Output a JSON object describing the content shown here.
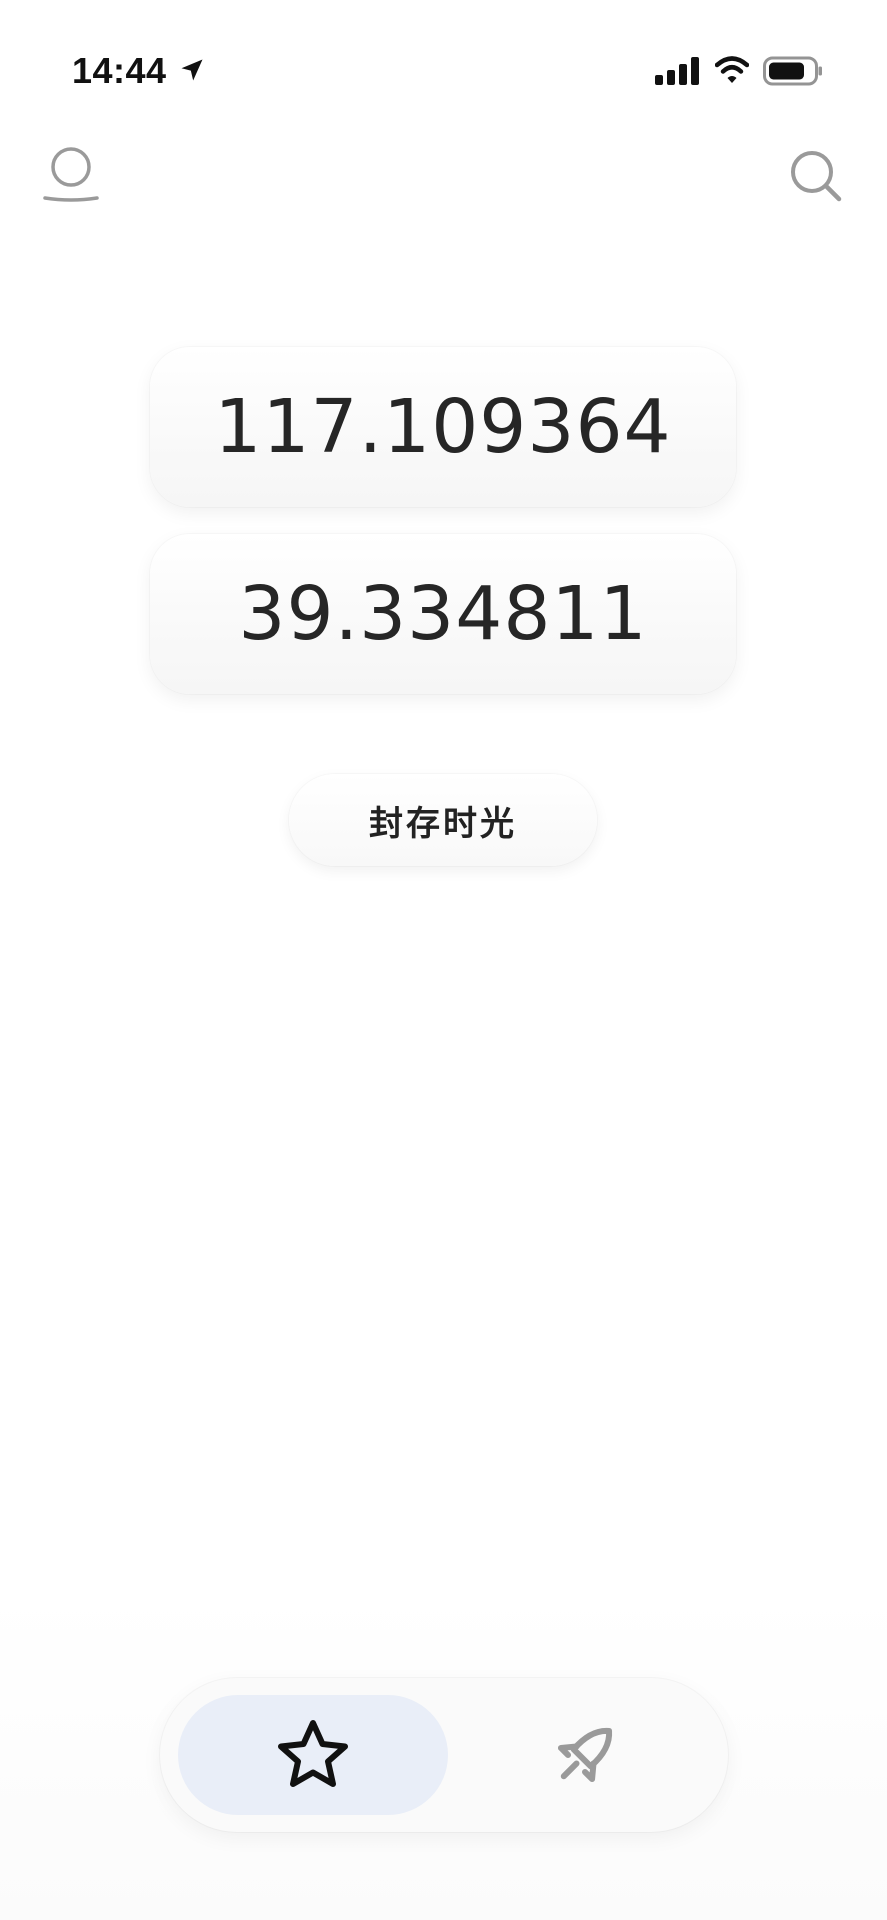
{
  "status_bar": {
    "time": "14:44",
    "icons": [
      "location-arrow-icon",
      "signal-icon",
      "wifi-icon",
      "battery-icon"
    ]
  },
  "header": {
    "left_icon": "profile-icon",
    "right_icon": "search-icon"
  },
  "coordinates": {
    "longitude": "117.109364",
    "latitude": "39.334811"
  },
  "actions": {
    "archive_label": "封存时光"
  },
  "tab_bar": {
    "tabs": [
      {
        "icon": "star-icon",
        "selected": true
      },
      {
        "icon": "rocket-icon",
        "selected": false
      }
    ]
  },
  "colors": {
    "selected_tab_bg": "#e9eef8",
    "inactive_icon": "#9a9a9a",
    "text": "#262626"
  }
}
